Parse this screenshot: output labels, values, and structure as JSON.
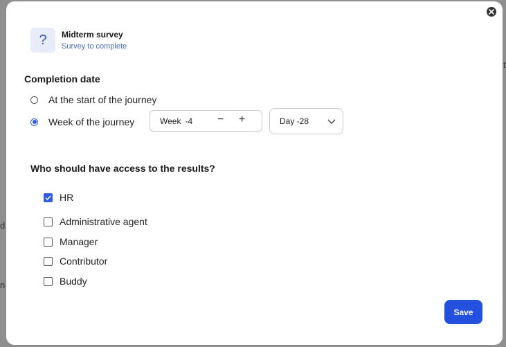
{
  "modal": {
    "title": "Midterm survey",
    "subtitle": "Survey to complete",
    "icon": "question-icon",
    "icon_glyph": "?"
  },
  "completion": {
    "label": "Completion date",
    "options": [
      {
        "label": "At the start of the journey",
        "selected": false
      },
      {
        "label": "Week of the journey",
        "selected": true
      }
    ],
    "week_label": "Week",
    "week_value": "-4",
    "minus": "−",
    "plus": "+",
    "day_value": "Day -28"
  },
  "access": {
    "label": "Who should have access to the results?",
    "options": [
      {
        "label": "HR",
        "checked": true
      },
      {
        "label": "Administrative agent",
        "checked": false
      },
      {
        "label": "Manager",
        "checked": false
      },
      {
        "label": "Contributor",
        "checked": false
      },
      {
        "label": "Buddy",
        "checked": false
      }
    ]
  },
  "save_label": "Save",
  "backdrop": {
    "left_char": "d",
    "left_char2": "n",
    "right_char": "t"
  },
  "colors": {
    "accent": "#2450e0",
    "subtitle": "#4a6ab8"
  }
}
